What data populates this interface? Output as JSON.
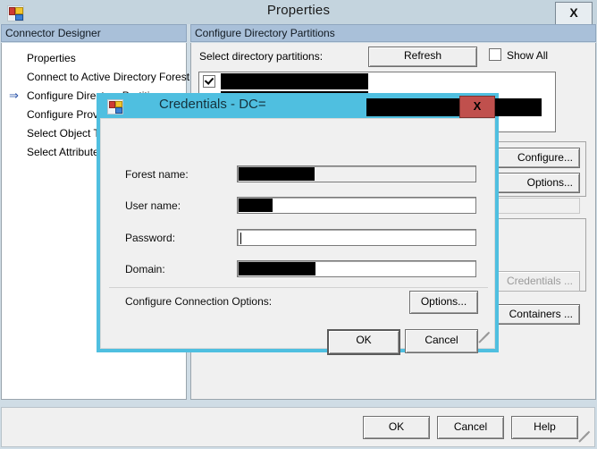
{
  "main_window": {
    "title": "Properties",
    "icon": "app-grid-icon",
    "close_label": "X",
    "left_header": "Connector Designer",
    "right_header": "Configure Directory Partitions",
    "nav_items": [
      {
        "label": "Properties",
        "active": false
      },
      {
        "label": "Connect to Active Directory Forest",
        "active": false
      },
      {
        "label": "Configure Directory Partitions",
        "active": true
      },
      {
        "label": "Configure Provisioning Hierarchy",
        "active": false
      },
      {
        "label": "Select Object Types",
        "active": false
      },
      {
        "label": "Select Attributes",
        "active": false
      }
    ],
    "active_marker": "⇒",
    "partitions": {
      "label": "Select directory partitions:",
      "refresh_label": "Refresh",
      "show_all_label": "Show All",
      "show_all_checked": false,
      "rows": [
        {
          "checked": true,
          "value": "[redacted]"
        },
        {
          "checked": true,
          "value": "[redacted]"
        }
      ]
    },
    "side_buttons": [
      {
        "label": "Configure...",
        "disabled": false
      },
      {
        "label": "Options...",
        "disabled": false
      },
      {
        "label": "",
        "disabled": true
      },
      {
        "label": "Credentials ...",
        "disabled": true
      },
      {
        "label": "Containers ...",
        "disabled": false
      }
    ],
    "footer_buttons": [
      {
        "label": "OK"
      },
      {
        "label": "Cancel"
      },
      {
        "label": "Help"
      }
    ]
  },
  "dialog": {
    "title_prefix": "Credentials - DC=",
    "title_redacted": true,
    "icon": "app-grid-icon",
    "close_label": "X",
    "fields": [
      {
        "label": "Forest name:",
        "value": "[redacted]",
        "readonly": true,
        "redacted": true,
        "redact_width": 85,
        "focused": false
      },
      {
        "label": "User name:",
        "value": "[redacted]",
        "readonly": false,
        "redacted": true,
        "redact_width": 38,
        "focused": false
      },
      {
        "label": "Password:",
        "value": "",
        "readonly": false,
        "redacted": false,
        "redact_width": 0,
        "focused": true
      },
      {
        "label": "Domain:",
        "value": "[redacted]",
        "readonly": false,
        "redacted": true,
        "redact_width": 86,
        "focused": false
      }
    ],
    "connection_options_label": "Configure Connection Options:",
    "options_button": "Options...",
    "ok_button": "OK",
    "cancel_button": "Cancel"
  },
  "colors": {
    "window_chrome": "#c4d4de",
    "header_band": "#a9c0d9",
    "dialog_border": "#4fbfe0",
    "dialog_close": "#c0504d",
    "panel_face": "#f0f0f0",
    "redaction": "#000000",
    "active_arrow": "#2a53a8"
  }
}
